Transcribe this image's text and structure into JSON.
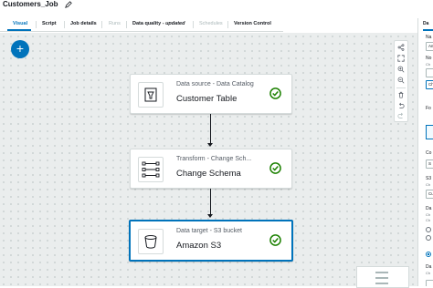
{
  "header": {
    "job_title": "Customers_Job"
  },
  "tabs": [
    {
      "label": "Visual",
      "state": "active"
    },
    {
      "label": "Script",
      "state": "normal"
    },
    {
      "label": "Job details",
      "state": "normal"
    },
    {
      "label": "Runs",
      "state": "disabled"
    },
    {
      "label": "Data quality - ",
      "state": "normal",
      "suffix": "updated"
    },
    {
      "label": "Schedules",
      "state": "disabled"
    },
    {
      "label": "Version Control",
      "state": "normal"
    }
  ],
  "canvas": {
    "add_button": "+",
    "nodes": [
      {
        "subtitle": "Data source - Data Catalog",
        "name": "Customer Table",
        "icon": "catalog-table-icon",
        "status": "success"
      },
      {
        "subtitle": "Transform - Change Sch...",
        "name": "Change Schema",
        "icon": "change-schema-icon",
        "status": "success"
      },
      {
        "subtitle": "Data target - S3 bucket",
        "name": "Amazon S3",
        "icon": "s3-bucket-icon",
        "status": "success",
        "selected": true
      }
    ]
  },
  "panel": {
    "tab": "Da",
    "labels": [
      "Na",
      "No",
      "Fo",
      "Co",
      "S3",
      "Da",
      "Da"
    ],
    "hints": [
      "Ch",
      "Ch",
      "Ch",
      "Ch",
      "Ch"
    ],
    "fields": [
      "Am",
      "Ch",
      "S",
      "Cu"
    ]
  },
  "colors": {
    "accent": "#0073bb",
    "success": "#1d8102",
    "canvas": "#eaeded"
  }
}
